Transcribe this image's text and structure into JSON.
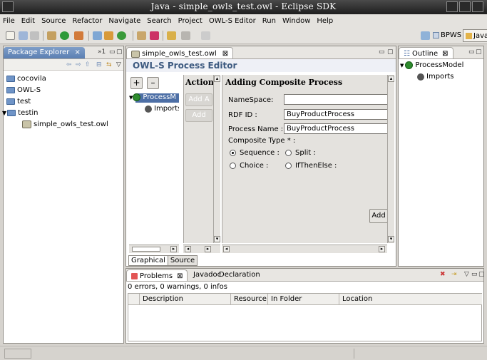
{
  "window": {
    "title": "Java - simple_owls_test.owl - Eclipse SDK"
  },
  "menu": [
    "File",
    "Edit",
    "Source",
    "Refactor",
    "Navigate",
    "Search",
    "Project",
    "OWL-S Editor",
    "Run",
    "Window",
    "Help"
  ],
  "perspectives": {
    "bpws": "BPWS",
    "java": "Java"
  },
  "package_explorer": {
    "tab_label": "Package Explorer",
    "overflow_label": "»1",
    "items": [
      {
        "label": "cocovila"
      },
      {
        "label": "OWL-S"
      },
      {
        "label": "test"
      },
      {
        "label": "testin"
      },
      {
        "label": "simple_owls_test.owl"
      }
    ]
  },
  "editor": {
    "tab_label": "simple_owls_test.owl",
    "title": "OWL-S Process Editor",
    "tree": {
      "root": "ProcessM",
      "child": "Imports"
    },
    "actions": {
      "header": "Actions",
      "add_label": "Add A",
      "add_comp_label": "Add Cor"
    },
    "form": {
      "title": "Adding Composite Process",
      "namespace_label": "NameSpace:",
      "namespace_value": "",
      "rdfid_label": "RDF ID :",
      "rdfid_value": "BuyProductProcess",
      "process_name_label": "Process Name :",
      "process_name_value": "BuyProductProcess",
      "composite_type_label": "Composite Type * :",
      "options": {
        "sequence": "Sequence :",
        "split": "Split :",
        "choice": "Choice :",
        "ifthenelse": "IfThenElse :"
      },
      "add_button": "Add"
    },
    "bottom_tabs": {
      "graphical": "Graphical",
      "source": "Source"
    }
  },
  "outline": {
    "tab_label": "Outline",
    "root": "ProcessModel",
    "child": "Imports"
  },
  "problems": {
    "tabs": {
      "problems": "Problems",
      "javadoc": "Javadoc",
      "declaration": "Declaration"
    },
    "summary": "0 errors, 0 warnings, 0 infos",
    "columns": [
      "Description",
      "Resource",
      "In Folder",
      "Location"
    ]
  }
}
